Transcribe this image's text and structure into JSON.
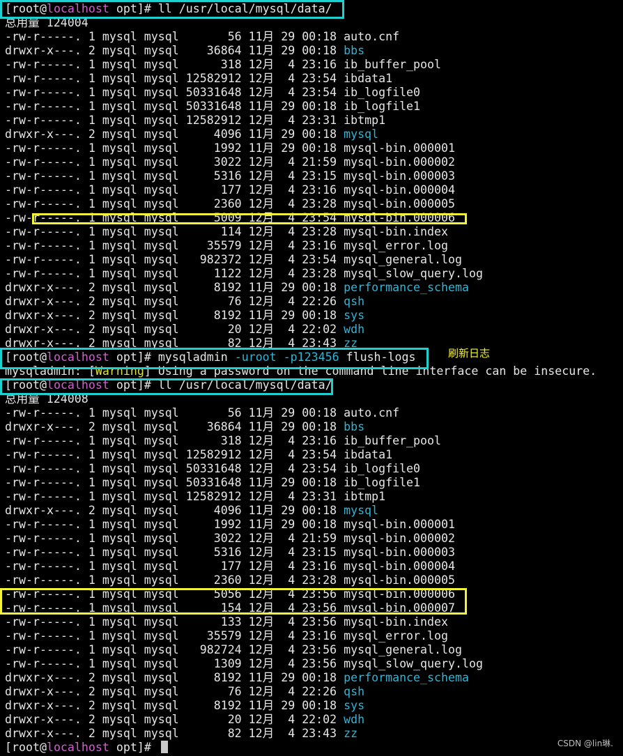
{
  "colors": {
    "background": "#000000",
    "text": "#e6e6e6",
    "dir": "#2fb5d6",
    "host": "#d65dd6",
    "cyan_box": "#1fd0d0",
    "yellow_box": "#f2f23a"
  },
  "prompt": {
    "user": "[root@",
    "host": "localhost",
    "path": " opt]# "
  },
  "commands": {
    "first": "ll /usr/local/mysql/data/",
    "flush_prefix": "mysqladmin ",
    "flush_user": "-uroot",
    "flush_pass": "-p123456",
    "flush_suffix": " flush-logs",
    "second": "ll /usr/local/mysql/data/"
  },
  "warning": {
    "prefix": "mysqladmin: [",
    "tag": "Warning",
    "suffix": "] Using a password on the command line interface can be insecure."
  },
  "listing1": {
    "total": "总用量 124004",
    "rows": [
      {
        "meta": "-rw-r-----. 1 mysql mysql       56 11月 29 00:18 ",
        "name": "auto.cnf",
        "dir": false
      },
      {
        "meta": "drwxr-x---. 2 mysql mysql    36864 11月 29 00:18 ",
        "name": "bbs",
        "dir": true
      },
      {
        "meta": "-rw-r-----. 1 mysql mysql      318 12月  4 23:16 ",
        "name": "ib_buffer_pool",
        "dir": false
      },
      {
        "meta": "-rw-r-----. 1 mysql mysql 12582912 12月  4 23:54 ",
        "name": "ibdata1",
        "dir": false
      },
      {
        "meta": "-rw-r-----. 1 mysql mysql 50331648 12月  4 23:54 ",
        "name": "ib_logfile0",
        "dir": false
      },
      {
        "meta": "-rw-r-----. 1 mysql mysql 50331648 11月 29 00:18 ",
        "name": "ib_logfile1",
        "dir": false
      },
      {
        "meta": "-rw-r-----. 1 mysql mysql 12582912 12月  4 23:31 ",
        "name": "ibtmp1",
        "dir": false
      },
      {
        "meta": "drwxr-x---. 2 mysql mysql     4096 11月 29 00:18 ",
        "name": "mysql",
        "dir": true
      },
      {
        "meta": "-rw-r-----. 1 mysql mysql     1992 11月 29 00:18 ",
        "name": "mysql-bin.000001",
        "dir": false
      },
      {
        "meta": "-rw-r-----. 1 mysql mysql     3022 12月  4 21:59 ",
        "name": "mysql-bin.000002",
        "dir": false
      },
      {
        "meta": "-rw-r-----. 1 mysql mysql     5316 12月  4 23:15 ",
        "name": "mysql-bin.000003",
        "dir": false
      },
      {
        "meta": "-rw-r-----. 1 mysql mysql      177 12月  4 23:16 ",
        "name": "mysql-bin.000004",
        "dir": false
      },
      {
        "meta": "-rw-r-----. 1 mysql mysql     2360 12月  4 23:28 ",
        "name": "mysql-bin.000005",
        "dir": false
      },
      {
        "meta": "-rw-r-----. 1 mysql mysql     5009 12月  4 23:54 ",
        "name": "mysql-bin.000006",
        "dir": false
      },
      {
        "meta": "-rw-r-----. 1 mysql mysql      114 12月  4 23:28 ",
        "name": "mysql-bin.index",
        "dir": false
      },
      {
        "meta": "-rw-r-----. 1 mysql mysql    35579 12月  4 23:16 ",
        "name": "mysql_error.log",
        "dir": false
      },
      {
        "meta": "-rw-r-----. 1 mysql mysql   982372 12月  4 23:54 ",
        "name": "mysql_general.log",
        "dir": false
      },
      {
        "meta": "-rw-r-----. 1 mysql mysql     1122 12月  4 23:28 ",
        "name": "mysql_slow_query.log",
        "dir": false
      },
      {
        "meta": "drwxr-x---. 2 mysql mysql     8192 11月 29 00:18 ",
        "name": "performance_schema",
        "dir": true
      },
      {
        "meta": "drwxr-x---. 2 mysql mysql       76 12月  4 22:26 ",
        "name": "qsh",
        "dir": true
      },
      {
        "meta": "drwxr-x---. 2 mysql mysql     8192 11月 29 00:18 ",
        "name": "sys",
        "dir": true
      },
      {
        "meta": "drwxr-x---. 2 mysql mysql       20 12月  4 22:02 ",
        "name": "wdh",
        "dir": true
      },
      {
        "meta": "drwxr-x---. 2 mysql mysql       82 12月  4 23:43 ",
        "name": "zz",
        "dir": true
      }
    ]
  },
  "listing2": {
    "total": "总用量 124008",
    "rows": [
      {
        "meta": "-rw-r-----. 1 mysql mysql       56 11月 29 00:18 ",
        "name": "auto.cnf",
        "dir": false
      },
      {
        "meta": "drwxr-x---. 2 mysql mysql    36864 11月 29 00:18 ",
        "name": "bbs",
        "dir": true
      },
      {
        "meta": "-rw-r-----. 1 mysql mysql      318 12月  4 23:16 ",
        "name": "ib_buffer_pool",
        "dir": false
      },
      {
        "meta": "-rw-r-----. 1 mysql mysql 12582912 12月  4 23:54 ",
        "name": "ibdata1",
        "dir": false
      },
      {
        "meta": "-rw-r-----. 1 mysql mysql 50331648 12月  4 23:54 ",
        "name": "ib_logfile0",
        "dir": false
      },
      {
        "meta": "-rw-r-----. 1 mysql mysql 50331648 11月 29 00:18 ",
        "name": "ib_logfile1",
        "dir": false
      },
      {
        "meta": "-rw-r-----. 1 mysql mysql 12582912 12月  4 23:31 ",
        "name": "ibtmp1",
        "dir": false
      },
      {
        "meta": "drwxr-x---. 2 mysql mysql     4096 11月 29 00:18 ",
        "name": "mysql",
        "dir": true
      },
      {
        "meta": "-rw-r-----. 1 mysql mysql     1992 11月 29 00:18 ",
        "name": "mysql-bin.000001",
        "dir": false
      },
      {
        "meta": "-rw-r-----. 1 mysql mysql     3022 12月  4 21:59 ",
        "name": "mysql-bin.000002",
        "dir": false
      },
      {
        "meta": "-rw-r-----. 1 mysql mysql     5316 12月  4 23:15 ",
        "name": "mysql-bin.000003",
        "dir": false
      },
      {
        "meta": "-rw-r-----. 1 mysql mysql      177 12月  4 23:16 ",
        "name": "mysql-bin.000004",
        "dir": false
      },
      {
        "meta": "-rw-r-----. 1 mysql mysql     2360 12月  4 23:28 ",
        "name": "mysql-bin.000005",
        "dir": false
      },
      {
        "meta": "-rw-r-----. 1 mysql mysql     5056 12月  4 23:56 ",
        "name": "mysql-bin.000006",
        "dir": false
      },
      {
        "meta": "-rw-r-----. 1 mysql mysql      154 12月  4 23:56 ",
        "name": "mysql-bin.000007",
        "dir": false
      },
      {
        "meta": "-rw-r-----. 1 mysql mysql      133 12月  4 23:56 ",
        "name": "mysql-bin.index",
        "dir": false
      },
      {
        "meta": "-rw-r-----. 1 mysql mysql    35579 12月  4 23:16 ",
        "name": "mysql_error.log",
        "dir": false
      },
      {
        "meta": "-rw-r-----. 1 mysql mysql   982724 12月  4 23:56 ",
        "name": "mysql_general.log",
        "dir": false
      },
      {
        "meta": "-rw-r-----. 1 mysql mysql     1309 12月  4 23:56 ",
        "name": "mysql_slow_query.log",
        "dir": false
      },
      {
        "meta": "drwxr-x---. 2 mysql mysql     8192 11月 29 00:18 ",
        "name": "performance_schema",
        "dir": true
      },
      {
        "meta": "drwxr-x---. 2 mysql mysql       76 12月  4 22:26 ",
        "name": "qsh",
        "dir": true
      },
      {
        "meta": "drwxr-x---. 2 mysql mysql     8192 11月 29 00:18 ",
        "name": "sys",
        "dir": true
      },
      {
        "meta": "drwxr-x---. 2 mysql mysql       20 12月  4 22:02 ",
        "name": "wdh",
        "dir": true
      },
      {
        "meta": "drwxr-x---. 2 mysql mysql       82 12月  4 23:43 ",
        "name": "zz",
        "dir": true
      }
    ]
  },
  "annotation": "刷新日志",
  "watermark": "CSDN @lin琳."
}
